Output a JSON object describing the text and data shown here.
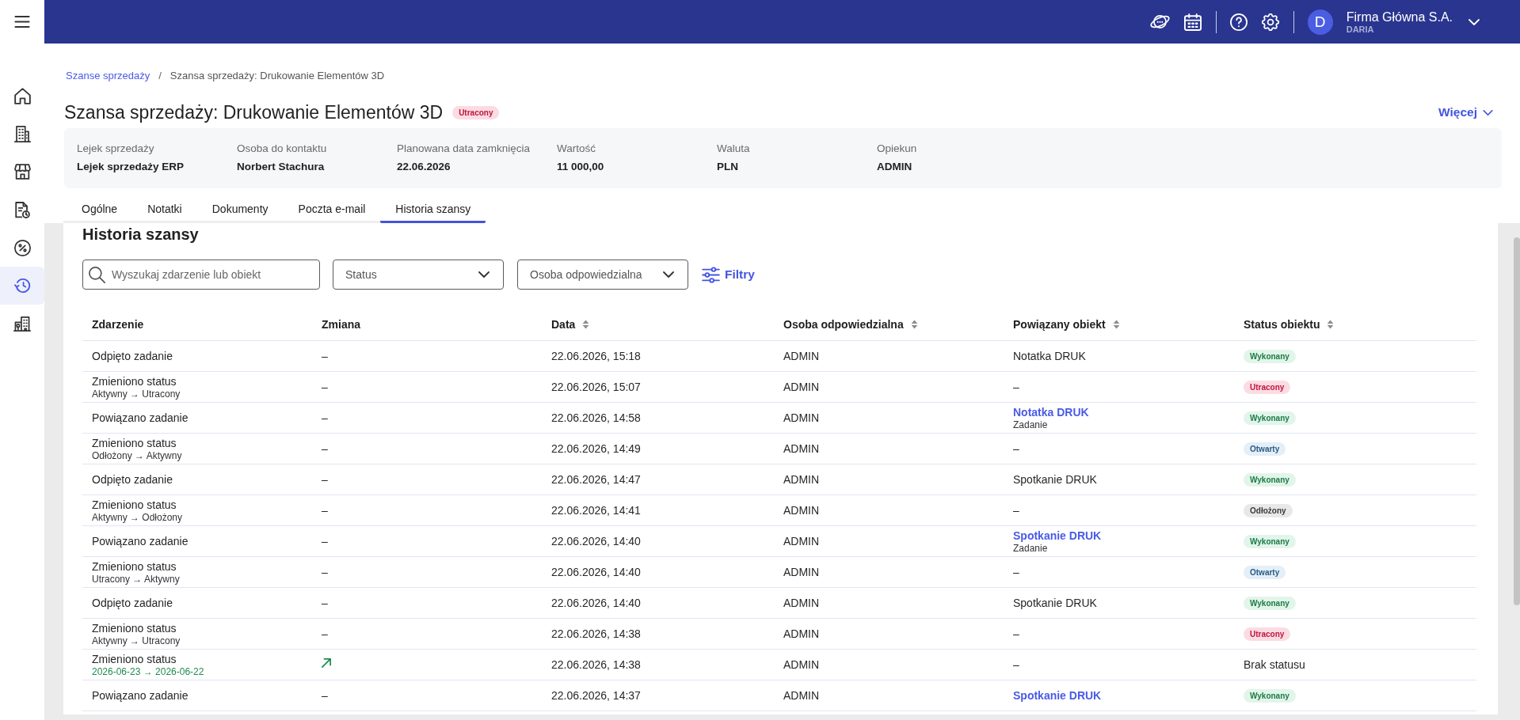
{
  "top_bar": {
    "company": "Firma Główna S.A.",
    "user": "DARIA",
    "avatar_letter": "D"
  },
  "sidebar": {
    "items": [
      {
        "selected": false
      },
      {
        "selected": false
      },
      {
        "selected": false
      },
      {
        "selected": false
      },
      {
        "selected": false
      },
      {
        "selected": true
      },
      {
        "selected": false
      }
    ]
  },
  "breadcrumb": {
    "items": [
      {
        "text": "Szanse sprzedaży",
        "link": true
      },
      {
        "text": "Szansa sprzedaży: Drukowanie Elementów 3D",
        "link": false
      }
    ],
    "separator": "/"
  },
  "header": {
    "title": "Szansa sprzedaży: Drukowanie Elementów 3D",
    "status": {
      "kind": "lost",
      "text": "Utracony"
    },
    "more_button": "Więcej"
  },
  "summary": [
    {
      "label": "Lejek sprzedaży",
      "value": "Lejek sprzedaży ERP"
    },
    {
      "label": "Osoba do kontaktu",
      "value": "Norbert Stachura"
    },
    {
      "label": "Planowana data zamknięcia",
      "value": "22.06.2026"
    },
    {
      "label": "Wartość",
      "value": "11 000,00"
    },
    {
      "label": "Waluta",
      "value": "PLN"
    },
    {
      "label": "Opiekun",
      "value": "ADMIN"
    }
  ],
  "tabs": [
    {
      "label": "Ogólne",
      "selected": false
    },
    {
      "label": "Notatki",
      "selected": false
    },
    {
      "label": "Dokumenty",
      "selected": false
    },
    {
      "label": "Poczta e-mail",
      "selected": false
    },
    {
      "label": "Historia szansy",
      "selected": true
    }
  ],
  "history": {
    "title": "Historia szansy",
    "search": {
      "placeholder": "Wyszukaj zdarzenie lub obiekt"
    },
    "dropdowns": [
      {
        "placeholder": "Status"
      },
      {
        "placeholder": "Osoba odpowiedzialna"
      }
    ],
    "filter_button": "Filtry",
    "table": {
      "columns": [
        {
          "label": "Zdarzenie",
          "sortable": false
        },
        {
          "label": "Zmiana",
          "sortable": false
        },
        {
          "label": "Data",
          "sortable": true
        },
        {
          "label": "Osoba odpowiedzialna",
          "sortable": true
        },
        {
          "label": "Powiązany obiekt",
          "sortable": true
        },
        {
          "label": "Status obiektu",
          "sortable": true
        }
      ],
      "rows": [
        {
          "event": "Odpięto zadanie",
          "change": {
            "kind": "text",
            "text": "–"
          },
          "date": "22.06.2026, 15:18",
          "person": "ADMIN",
          "object": {
            "text": "Notatka DRUK",
            "link": false
          },
          "status": {
            "kind": "done",
            "text": "Wykonany"
          }
        },
        {
          "event": "Zmieniono status",
          "detail": {
            "kind": "status",
            "text": "Aktywny → Utracony"
          },
          "change": {
            "kind": "text",
            "text": "–"
          },
          "date": "22.06.2026, 15:07",
          "person": "ADMIN",
          "object": {
            "text": "–",
            "link": false
          },
          "status": {
            "kind": "lost",
            "text": "Utracony"
          }
        },
        {
          "event": "Powiązano zadanie",
          "change": {
            "kind": "text",
            "text": "–"
          },
          "date": "22.06.2026, 14:58",
          "person": "ADMIN",
          "object": {
            "text": "Notatka DRUK",
            "link": true,
            "type": "Zadanie"
          },
          "status": {
            "kind": "done",
            "text": "Wykonany"
          }
        },
        {
          "event": "Zmieniono status",
          "detail": {
            "kind": "status",
            "text": "Odłożony → Aktywny"
          },
          "change": {
            "kind": "text",
            "text": "–"
          },
          "date": "22.06.2026, 14:49",
          "person": "ADMIN",
          "object": {
            "text": "–",
            "link": false
          },
          "status": {
            "kind": "open",
            "text": "Otwarty"
          }
        },
        {
          "event": "Odpięto zadanie",
          "change": {
            "kind": "text",
            "text": "–"
          },
          "date": "22.06.2026, 14:47",
          "person": "ADMIN",
          "object": {
            "text": "Spotkanie DRUK",
            "link": false
          },
          "status": {
            "kind": "done",
            "text": "Wykonany"
          }
        },
        {
          "event": "Zmieniono status",
          "detail": {
            "kind": "status",
            "text": "Aktywny → Odłożony"
          },
          "change": {
            "kind": "text",
            "text": "–"
          },
          "date": "22.06.2026, 14:41",
          "person": "ADMIN",
          "object": {
            "text": "–",
            "link": false
          },
          "status": {
            "kind": "postponed",
            "text": "Odłożony"
          }
        },
        {
          "event": "Powiązano zadanie",
          "change": {
            "kind": "text",
            "text": "–"
          },
          "date": "22.06.2026, 14:40",
          "person": "ADMIN",
          "object": {
            "text": "Spotkanie DRUK",
            "link": true,
            "type": "Zadanie"
          },
          "status": {
            "kind": "done",
            "text": "Wykonany"
          }
        },
        {
          "event": "Zmieniono status",
          "detail": {
            "kind": "status",
            "text": "Utracony → Aktywny"
          },
          "change": {
            "kind": "text",
            "text": "–"
          },
          "date": "22.06.2026, 14:40",
          "person": "ADMIN",
          "object": {
            "text": "–",
            "link": false
          },
          "status": {
            "kind": "open",
            "text": "Otwarty"
          }
        },
        {
          "event": "Odpięto zadanie",
          "change": {
            "kind": "text",
            "text": "–"
          },
          "date": "22.06.2026, 14:40",
          "person": "ADMIN",
          "object": {
            "text": "Spotkanie DRUK",
            "link": false
          },
          "status": {
            "kind": "done",
            "text": "Wykonany"
          }
        },
        {
          "event": "Zmieniono status",
          "detail": {
            "kind": "status",
            "text": "Aktywny → Utracony"
          },
          "change": {
            "kind": "text",
            "text": "–"
          },
          "date": "22.06.2026, 14:38",
          "person": "ADMIN",
          "object": {
            "text": "–",
            "link": false
          },
          "status": {
            "kind": "lost",
            "text": "Utracony"
          }
        },
        {
          "event": "Zmieniono status",
          "detail": {
            "kind": "date",
            "text": "2026-06-23 → 2026-06-22"
          },
          "change": {
            "kind": "arrow"
          },
          "date": "22.06.2026, 14:38",
          "person": "ADMIN",
          "object": {
            "text": "–",
            "link": false
          },
          "status": {
            "kind": "none",
            "text": "Brak statusu"
          }
        },
        {
          "event": "Powiązano zadanie",
          "change": {
            "kind": "text",
            "text": "–"
          },
          "date": "22.06.2026, 14:37",
          "person": "ADMIN",
          "object": {
            "text": "Spotkanie DRUK",
            "link": true
          },
          "status": {
            "kind": "done",
            "text": "Wykonany"
          }
        }
      ]
    }
  }
}
